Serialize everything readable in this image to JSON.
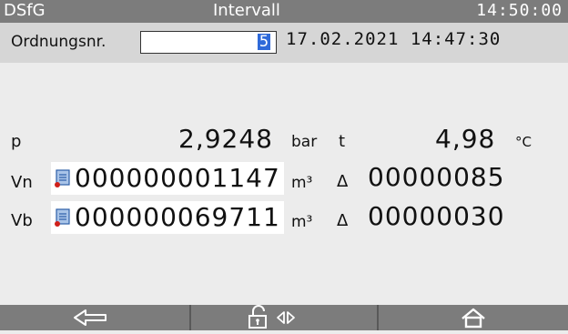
{
  "header": {
    "left": "DSfG",
    "title": "Intervall",
    "time": "14:50:00"
  },
  "ordnung": {
    "label": "Ordnungsnr.",
    "value": "5",
    "datetime": "17.02.2021 14:47:30"
  },
  "pressure": {
    "label": "p",
    "value": "2,9248",
    "unit": "bar"
  },
  "temperature": {
    "label": "t",
    "value": "4,98",
    "unit": "°C"
  },
  "vn": {
    "label": "Vn",
    "counter": "000000001147",
    "unit": "m³",
    "delta_symbol": "Δ",
    "delta": "00000085"
  },
  "vb": {
    "label": "Vb",
    "counter": "000000069711",
    "unit": "m³",
    "delta_symbol": "Δ",
    "delta": "00000030"
  },
  "icons": [
    "back-arrow-icon",
    "unlock-icon",
    "left-right-icon",
    "home-icon",
    "document-icon"
  ],
  "colors": {
    "title_bar": "#7c7c7c",
    "selection": "#2f6ad9",
    "marker": "#d0201a"
  }
}
